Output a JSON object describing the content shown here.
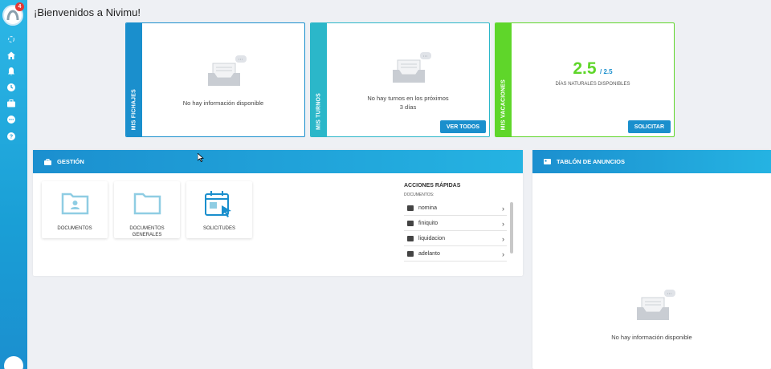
{
  "sidebar": {
    "notification_count": "4",
    "icons": [
      "loading-icon",
      "home-icon",
      "bell-icon",
      "clock-icon",
      "briefcase-icon",
      "chat-icon",
      "help-icon"
    ]
  },
  "page_title": "¡Bienvenidos a Nivimu!",
  "cards": {
    "fichajes": {
      "label": "MIS FICHAJES",
      "message": "No hay información disponible",
      "color": "#1a8fcd"
    },
    "turnos": {
      "label": "MIS TURNOS",
      "message_line1": "No hay turnos en los próximos",
      "message_line2": "3 días",
      "button": "VER TODOS",
      "color": "#2bb7c9"
    },
    "vacaciones": {
      "label": "MIS VACACIONES",
      "value": "2.5",
      "total": "/ 2.5",
      "caption": "DÍAS NATURALES DISPONIBLES",
      "button": "SOLICITAR",
      "color": "#5fd62a"
    }
  },
  "gestion": {
    "title": "GESTIÓN",
    "tiles": [
      {
        "label": "DOCUMENTOS"
      },
      {
        "label_line1": "DOCUMENTOS",
        "label_line2": "GENERALES"
      },
      {
        "label": "SOLICITUDES"
      }
    ],
    "quick_actions": {
      "title": "ACCIONES RÁPIDAS",
      "subtitle": "DOCUMENTOS:",
      "items": [
        "nomina",
        "finiquito",
        "liquidacion",
        "adelanto"
      ]
    }
  },
  "anuncios": {
    "title": "TABLÓN DE ANUNCIOS",
    "message": "No hay información disponible"
  }
}
